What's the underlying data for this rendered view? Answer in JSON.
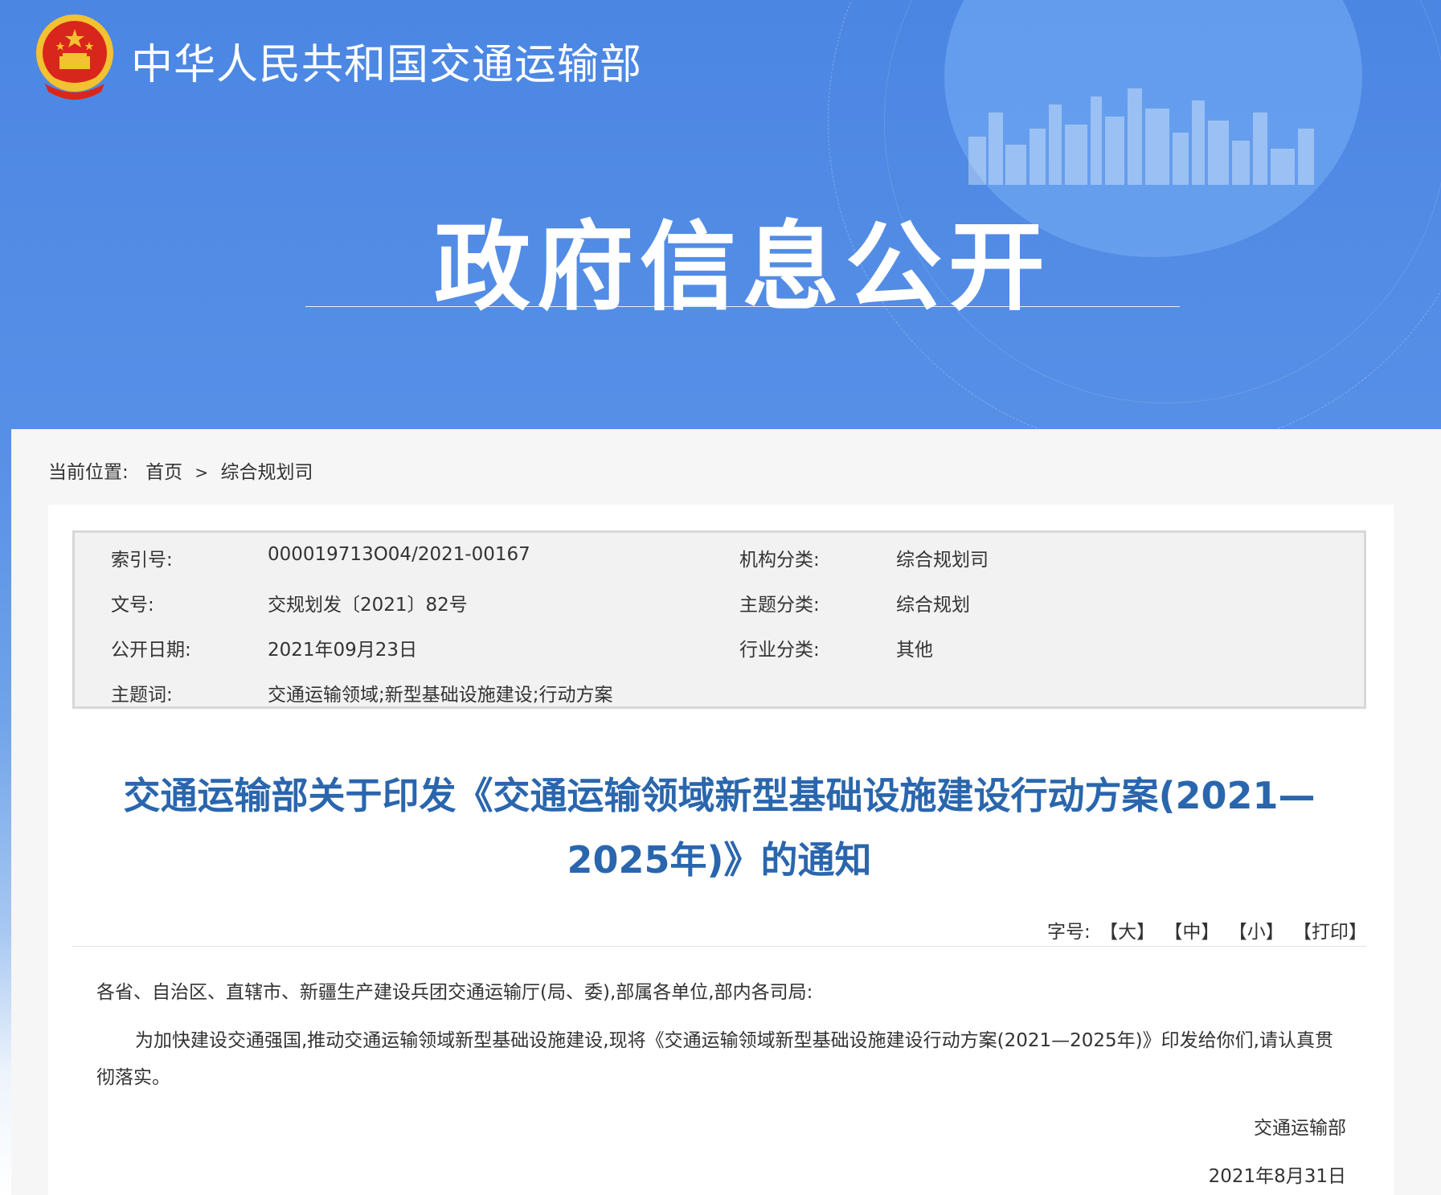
{
  "header": {
    "ministry_name": "中华人民共和国交通运输部",
    "section_title": "政府信息公开"
  },
  "breadcrumb": {
    "label": "当前位置:",
    "items": [
      "首页",
      "综合规划司"
    ],
    "separator": ">"
  },
  "meta": {
    "index_label": "索引号:",
    "index_value": "000019713O04/2021-00167",
    "org_label": "机构分类:",
    "org_value": "综合规划司",
    "doc_no_label": "文号:",
    "doc_no_value": "交规划发〔2021〕82号",
    "topic_label": "主题分类:",
    "topic_value": "综合规划",
    "date_label": "公开日期:",
    "date_value": "2021年09月23日",
    "industry_label": "行业分类:",
    "industry_value": "其他",
    "keywords_label": "主题词:",
    "keywords_value": "交通运输领域;新型基础设施建设;行动方案"
  },
  "article": {
    "title": "交通运输部关于印发《交通运输领域新型基础设施建设行动方案(2021—2025年)》的通知",
    "font_size_label": "字号:",
    "tools": [
      "【大】",
      "【中】",
      "【小】",
      "【打印】"
    ],
    "salutation": "各省、自治区、直辖市、新疆生产建设兵团交通运输厅(局、委),部属各单位,部内各司局:",
    "paragraph": "为加快建设交通强国,推动交通运输领域新型基础设施建设,现将《交通运输领域新型基础设施建设行动方案(2021—2025年)》印发给你们,请认真贯彻落实。",
    "signature_org": "交通运输部",
    "signature_date": "2021年8月31日"
  },
  "colors": {
    "banner_blue": "#4b86e3",
    "title_blue": "#2a66ad",
    "emblem_red": "#d9261c",
    "emblem_gold": "#f2c230"
  }
}
